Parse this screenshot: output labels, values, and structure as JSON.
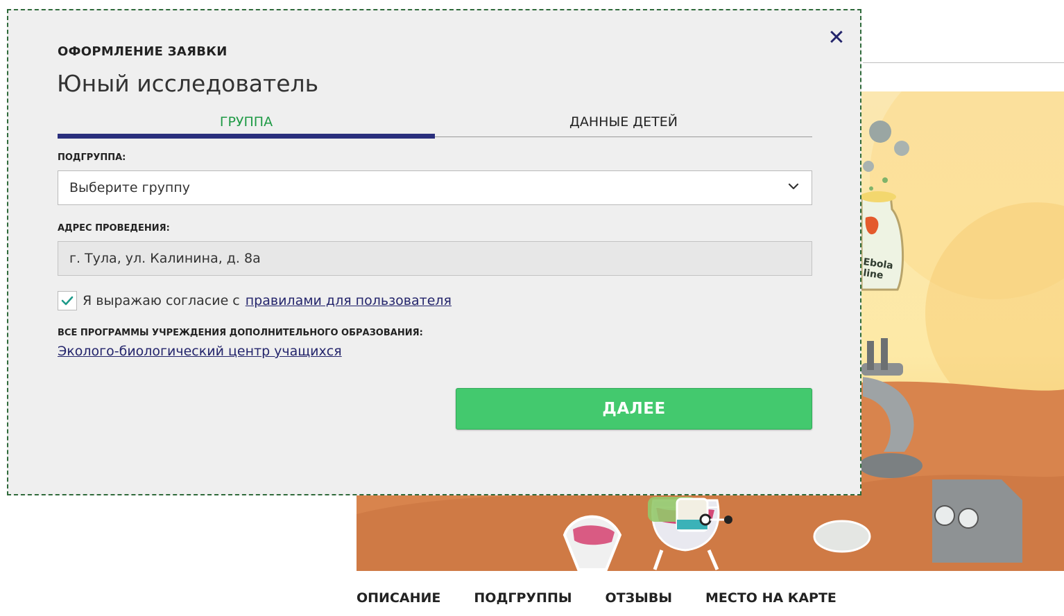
{
  "modal": {
    "eyebrow": "ОФОРМЛЕНИЕ ЗАЯВКИ",
    "title": "Юный исследователь",
    "close_icon": "close-icon",
    "steps": [
      {
        "label": "ГРУППА",
        "active": true
      },
      {
        "label": "ДАННЫЕ ДЕТЕЙ",
        "active": false
      }
    ],
    "subgroup_label": "ПОДГРУППА:",
    "subgroup_select_value": "Выберите группу",
    "address_label": "АДРЕС ПРОВЕДЕНИЯ:",
    "address_value": "г. Тула, ул. Калинина, д. 8а",
    "consent_text": "Я выражаю согласие с",
    "consent_link": "правилами для пользователя",
    "consent_checked": true,
    "all_programs_label": "ВСЕ ПРОГРАММЫ УЧРЕЖДЕНИЯ ДОПОЛНИТЕЛЬНОГО ОБРАЗОВАНИЯ:",
    "organization_link": "Эколого-биологический центр учащихся",
    "next_button": "ДАЛЕЕ"
  },
  "page_tabs": [
    "ОПИСАНИЕ",
    "ПОДГРУППЫ",
    "ОТЗЫВЫ",
    "МЕСТО НА КАРТЕ"
  ],
  "hero_label": "Ebola\nline",
  "colors": {
    "accent_green": "#43c96e",
    "step_active_text": "#1e9a45",
    "progress_bar": "#2a2f7d",
    "link": "#23246b",
    "modal_bg": "#efefef"
  }
}
